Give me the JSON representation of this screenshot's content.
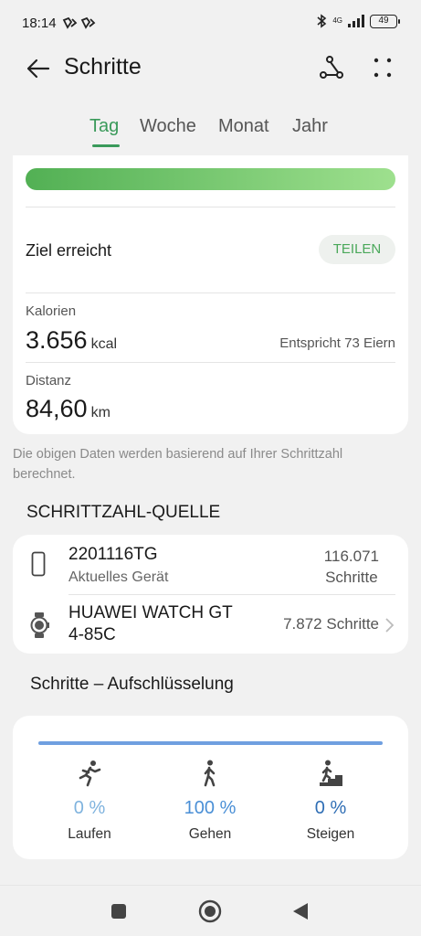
{
  "status_bar": {
    "time": "18:14",
    "network": "4G",
    "battery": "49"
  },
  "app_bar": {
    "title": "Schritte"
  },
  "tabs": [
    {
      "label": "Tag",
      "active": true
    },
    {
      "label": "Woche",
      "active": false
    },
    {
      "label": "Monat",
      "active": false
    },
    {
      "label": "Jahr",
      "active": false
    }
  ],
  "summary": {
    "progress": 1.0,
    "goal_text": "Ziel erreicht",
    "share_label": "TEILEN",
    "calories_label": "Kalorien",
    "calories_value": "3.656",
    "calories_unit": "kcal",
    "calories_equiv": "Entspricht 73 Eiern",
    "distance_label": "Distanz",
    "distance_value": "84,60",
    "distance_unit": "km"
  },
  "note": "Die obigen Daten werden basierend auf Ihrer Schrittzahl berechnet.",
  "source": {
    "heading": "SCHRITTZAHL-QUELLE",
    "devices": [
      {
        "name": "2201116TG",
        "subtitle": "Aktuelles Gerät",
        "steps": "116.071",
        "steps_label": "Schritte",
        "icon": "phone-icon"
      },
      {
        "name_line1": "HUAWEI WATCH GT",
        "name_line2": "4-85C",
        "steps_text": "7.872 Schritte",
        "icon": "watch-icon"
      }
    ]
  },
  "breakdown": {
    "heading": "Schritte – Aufschlüsselung",
    "items": [
      {
        "label": "Laufen",
        "percent": "0 %",
        "icon": "running-icon",
        "color": "#7fb3de"
      },
      {
        "label": "Gehen",
        "percent": "100 %",
        "icon": "walking-icon",
        "color": "#4a8fd6"
      },
      {
        "label": "Steigen",
        "percent": "0 %",
        "icon": "climbing-icon",
        "color": "#2f6eb5"
      }
    ]
  },
  "colors": {
    "accent_green": "#3a9a5a",
    "bar_blue": "#6f9fe0"
  }
}
